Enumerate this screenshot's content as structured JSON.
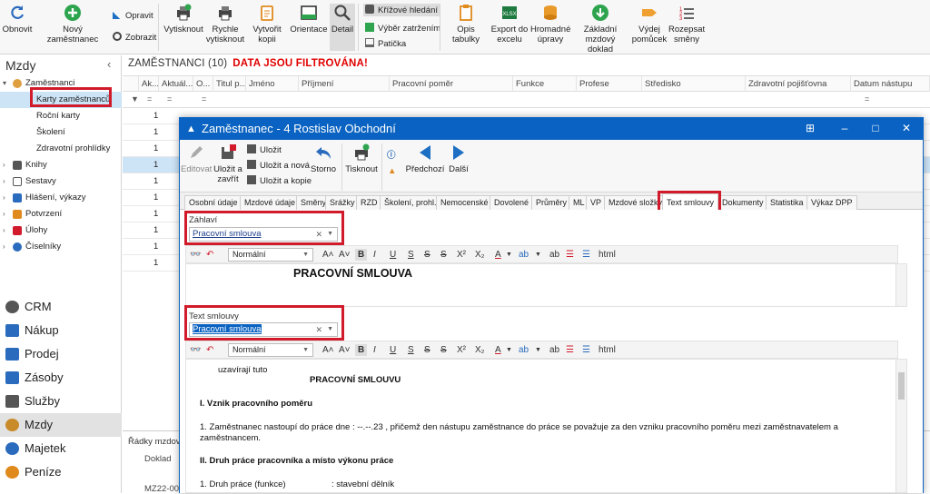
{
  "ribbon": {
    "refresh": "Obnovit",
    "new_employee": "Nový zaměstnanec",
    "edit": "Opravit",
    "show": "Zobrazit",
    "print": "Vytisknout",
    "quick_print": "Rychle vytisknout",
    "make_copy": "Vytvořit kopii",
    "orientation": "Orientace",
    "detail": "Detail",
    "cross_search": "Křížové hledání",
    "select_checked": "Výběr zatržením",
    "footer": "Patička",
    "edit_tables": "Opis tabulky",
    "export_excel": "Export do excelu",
    "bulk_edit": "Hromadné úpravy",
    "basic_payroll": "Základní mzdový doklad",
    "tool_issue": "Výdej pomůcek",
    "shift_schedule": "Rozepsat směny"
  },
  "sidebar": {
    "title": "Mzdy",
    "tree": [
      {
        "label": "Zaměstnanci",
        "level": 0,
        "expanded": true
      },
      {
        "label": "Karty zaměstnanců",
        "level": 1,
        "selected": true
      },
      {
        "label": "Roční karty",
        "level": 1
      },
      {
        "label": "Školení",
        "level": 1
      },
      {
        "label": "Zdravotní prohlídky",
        "level": 1
      },
      {
        "label": "Knihy",
        "level": 0
      },
      {
        "label": "Sestavy",
        "level": 0
      },
      {
        "label": "Hlášení, výkazy",
        "level": 0
      },
      {
        "label": "Potvrzení",
        "level": 0
      },
      {
        "label": "Úlohy",
        "level": 0
      },
      {
        "label": "Číselníky",
        "level": 0
      }
    ],
    "modules": [
      "CRM",
      "Nákup",
      "Prodej",
      "Zásoby",
      "Služby",
      "Mzdy",
      "Majetek",
      "Peníze"
    ],
    "selected_module": "Mzdy"
  },
  "main": {
    "title": "ZAMĚSTNANCI (10)",
    "filter_notice": "DATA JSOU FILTROVÁNA!",
    "columns": [
      "Ak...",
      "Aktuál...",
      "O...",
      "Titul p...",
      "Jméno",
      "Příjmení",
      "Pracovní poměr",
      "Funkce",
      "Profese",
      "Středisko",
      "Zdravotní pojišťovna",
      "Datum nástupu"
    ],
    "row_values": [
      "1",
      "1",
      "1",
      "1",
      "1",
      "1",
      "1",
      "1",
      "1",
      "1"
    ],
    "bottom_title": "Řádky mzdov...",
    "bottom_col": "Doklad",
    "bottom_row": "MZ22-00..."
  },
  "dialog": {
    "title": "Zaměstnanec - 4 Rostislav Obchodní",
    "toolbar": {
      "edit": "Editovat",
      "save_close": "Uložit a zavřít",
      "save": "Uložit",
      "save_new": "Uložit a nová",
      "save_copy": "Uložit a kopie",
      "cancel": "Storno",
      "print": "Tisknout",
      "prev": "Předchozí",
      "next": "Další"
    },
    "tabs": [
      "Osobní údaje",
      "Mzdové údaje",
      "Směny",
      "Srážky",
      "RZD",
      "Školení, prohl.",
      "Nemocenské",
      "Dovolené",
      "Průměry",
      "ML",
      "VP",
      "Mzdové složky",
      "Text smlouvy",
      "Dokumenty",
      "Statistika",
      "Výkaz DPP"
    ],
    "active_tab": "Text smlouvy",
    "header_label": "Záhlaví",
    "header_value": "Pracovní smlouva",
    "text_label": "Text smlouvy",
    "text_value": "Pracovní smlouva",
    "editor_style": "Normální",
    "editor_html": "html",
    "header_content": "PRACOVNÍ SMLOUVA",
    "doc": {
      "line1": "uzavírají tuto",
      "title": "PRACOVNÍ SMLOUVU",
      "sec1": "I.    Vznik pracovního poměru",
      "p1a": "1.    Zaměstnanec nastoupí do práce dne : --.--.23 , přičemž den nástupu zaměstnance do práce se považuje za den vzniku pracovního poměru mezi zaměstnavatelem a",
      "p1b": "zaměstnancem.",
      "sec2": "II.   Druh práce pracovníka a místo výkonu práce",
      "p2": "1.    Druh práce (funkce)",
      "p2v": ": stavební dělník"
    }
  },
  "colors": {
    "accent": "#0a63c2",
    "highlight": "#d11a2a",
    "filter_red": "#e00000",
    "selection": "#cde4f7"
  }
}
